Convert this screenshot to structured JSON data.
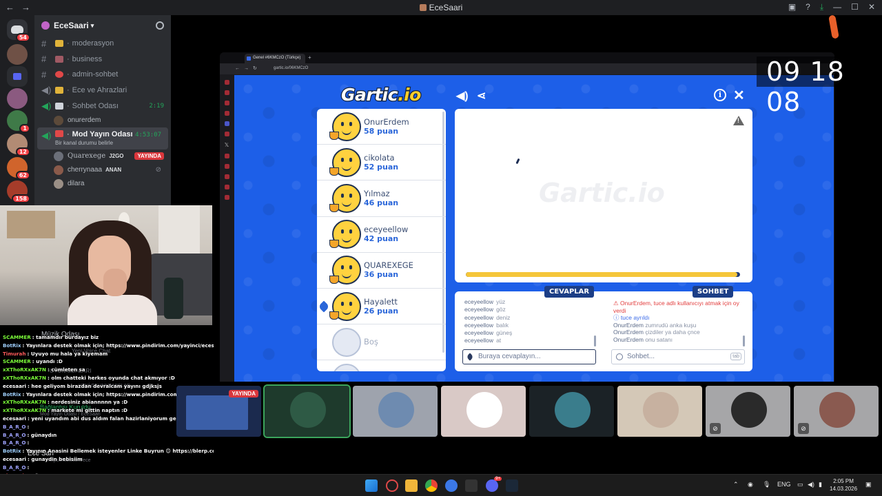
{
  "window": {
    "title": "EceSaari"
  },
  "rail": {
    "servers": [
      {
        "name": "home",
        "badge": "54",
        "color": "#313338"
      },
      {
        "name": "server-1",
        "badge": "",
        "color": "#6f5146"
      },
      {
        "name": "folder",
        "badge": "",
        "color": "#2b2d31"
      },
      {
        "name": "server-2",
        "badge": "",
        "color": "#8b5a80"
      },
      {
        "name": "server-3",
        "badge": "1",
        "color": "#3f7a48"
      },
      {
        "name": "server-4",
        "badge": "12",
        "color": "#b28b74"
      },
      {
        "name": "server-5",
        "badge": "62",
        "color": "#d0642c"
      },
      {
        "name": "server-6",
        "badge": "158",
        "color": "#a63c2a"
      }
    ]
  },
  "sidebar": {
    "server_name": "EceSaari",
    "channels": [
      {
        "type": "text",
        "emoji_color": "#e0b33a",
        "name": "moderasyon"
      },
      {
        "type": "text",
        "emoji_color": "#a05a64",
        "name": "business"
      },
      {
        "type": "text",
        "emoji_color": "#e04848",
        "name": "admin-sohbet"
      },
      {
        "type": "voice",
        "emoji_color": "#e0b33a",
        "name": "Ece ve Ahrazlari"
      },
      {
        "type": "voice",
        "emoji_color": "#cfd3da",
        "name": "Sohbet Odası",
        "time": "2:19"
      }
    ],
    "voice_user_1": {
      "name": "onurerdem"
    },
    "active_channel": {
      "name": "Mod Yayın Odası",
      "time": "4:53:07",
      "status": "Bir kanal durumu belirle"
    },
    "active_users": [
      {
        "name": "Quarexege",
        "tag": "J2GO",
        "live": "YAYINDA",
        "color": "#6b6f79"
      },
      {
        "name": "cherrynaaa",
        "tag": "ANAN",
        "color": "#8a5a4a"
      },
      {
        "name": "dilara",
        "tag": "",
        "color": "#9a8f86"
      }
    ]
  },
  "chat": [
    {
      "user": "SCAMMER",
      "color": "#7cfc3a",
      "text": ": tamamdır burdayız biz"
    },
    {
      "user": "BotRix",
      "color": "#9fd0ff",
      "text": ": Yayınlara destek olmak için; https://www.pindirim.com/yayinci/ecesaari?ref"
    },
    {
      "user": "Timurah",
      "color": "#ff5a5a",
      "text": ": Uyuyo mu hala ya kiyemam"
    },
    {
      "user": "SCAMMER",
      "color": "#7cfc3a",
      "text": ": uyandı :D"
    },
    {
      "user": "xXThoRXxAK7N",
      "color": "#7cfc3a",
      "text": ": cümleten sa"
    },
    {
      "user": "xXThoRXxAK7N",
      "color": "#7cfc3a",
      "text": ": olm chatteki herkes oyunda chat akmıyor :D"
    },
    {
      "user": "ecesaari",
      "color": "#ffffff",
      "text": ": hee geliyom birazdan devralcam yayını gdjksjs"
    },
    {
      "user": "BotRix",
      "color": "#9fd0ff",
      "text": ": Yayınlara destek olmak için; https://www.pindirim.com/yayinci/ecesaari?ref"
    },
    {
      "user": "xXThoRXxAK7N",
      "color": "#7cfc3a",
      "text": ": nerdesiniz abiannnnn ya :D"
    },
    {
      "user": "xXThoRXxAK7N",
      "color": "#7cfc3a",
      "text": ": markete mi gittin naptın :D"
    },
    {
      "user": "ecesaari",
      "color": "#ffffff",
      "text": ": yeni uyandım abi dus aldım falan hazirlaniyorum gelicem 2dkya"
    },
    {
      "user": "B_A_R_O",
      "color": "#9fa3ff",
      "text": ": "
    },
    {
      "user": "B_A_R_O",
      "color": "#9fa3ff",
      "text": ": günaydın"
    },
    {
      "user": "B_A_R_O",
      "color": "#9fa3ff",
      "text": ": "
    },
    {
      "user": "BotRix",
      "color": "#9fd0ff",
      "text": ": Yayının Anasini Bellemek isteyenler Linke Buyrun 😊 https://blerp.com/x/ecesaari"
    },
    {
      "user": "ecesaari",
      "color": "#ffffff",
      "text": ": gunaydin bebisiim"
    },
    {
      "user": "B_A_R_O",
      "color": "#9fa3ff",
      "text": ": "
    },
    {
      "user": "Timurah",
      "color": "#ff5a5a",
      "text": ": Günooo"
    }
  ],
  "ghost": {
    "music": "Müzik Odası",
    "voice_chat": "Yeni Voice Chat",
    "game_rooms": "OYUN ODALARI",
    "game_sub": "YENİ OKUNMAMIŞLAR",
    "connection": "Bağlantısı Kuruldu",
    "connection_sub": "Mod Yayın Odası / EceSaari",
    "user": "Ece Sari",
    "link": "https://kick.com/ece"
  },
  "browser": {
    "tab": "Genel #6KMCzO (Türkçe)",
    "url": "gartic.io/06KMCzO"
  },
  "game": {
    "logo_main": "Gartic",
    "logo_io": ".io",
    "players": [
      {
        "name": "OnurErdem",
        "points": "58 puan",
        "color": "#ffd23f",
        "drawing": false
      },
      {
        "name": "cikolata",
        "points": "52 puan",
        "color": "#ffd23f",
        "drawing": false
      },
      {
        "name": "Yılmaz",
        "points": "46 puan",
        "color": "#ffd23f",
        "drawing": false
      },
      {
        "name": "eceyeellow",
        "points": "42 puan",
        "color": "#ffd23f",
        "drawing": false
      },
      {
        "name": "QUAREXEGE",
        "points": "36 puan",
        "color": "#ffd23f",
        "drawing": false
      },
      {
        "name": "Hayalett",
        "points": "26 puan",
        "color": "#ffd23f",
        "drawing": true
      }
    ],
    "empty_slot": "Boş",
    "canvas_watermark": "Gartic.io",
    "timer_progress": 0.99,
    "answers_tab": "CEVAPLAR",
    "chat_tab": "SOHBET",
    "answers": [
      {
        "user": "eceyeellow",
        "word": "yüz"
      },
      {
        "user": "eceyeellow",
        "word": "göz"
      },
      {
        "user": "eceyeellow",
        "word": "deniz"
      },
      {
        "user": "eceyeellow",
        "word": "balık"
      },
      {
        "user": "eceyeellow",
        "word": "güneş"
      },
      {
        "user": "eceyeellow",
        "word": "at"
      }
    ],
    "chat_lines": {
      "kick_user": "OnurErdem, tuce",
      "kick_text": " adlı kullanıcıyı atmak için oy verdi",
      "left_user": "tuce",
      "left_text": " ayrıldı",
      "msgs": [
        {
          "user": "OnurErdem",
          "text": "zumrudü anka kuşu"
        },
        {
          "user": "OnurErdem",
          "text": "çizdiler ya daha çnce"
        },
        {
          "user": "OnurErdem",
          "text": "onu satanı"
        }
      ]
    },
    "answer_placeholder": "Buraya cevaplayın...",
    "chat_placeholder": "Sohbet...",
    "tab_key": "tab"
  },
  "clock_overlay": "09 18 08",
  "tiles": [
    {
      "color": "#1b2a4e",
      "live": "YAYINDA",
      "circle": ""
    },
    {
      "color": "#1e3a2c",
      "circle": "#2e5a45",
      "selected": true
    },
    {
      "color": "#9ea3ad",
      "circle": "#6e8bb0"
    },
    {
      "color": "#d9c9c6",
      "circle": "#ffffff"
    },
    {
      "color": "#1b2226",
      "circle": "#3a7d8c"
    },
    {
      "color": "#d4c8b7",
      "circle": "#c7b1a0"
    },
    {
      "color": "#a6a6a8",
      "circle": "#2a2a2a",
      "muted": true
    },
    {
      "color": "#a6a6a8",
      "circle": "#8a5a50",
      "muted": true
    }
  ],
  "taskbar": {
    "lang": "ENG",
    "time": "2:05 PM",
    "date": "14.03.2026",
    "discord_badge": "9+"
  }
}
